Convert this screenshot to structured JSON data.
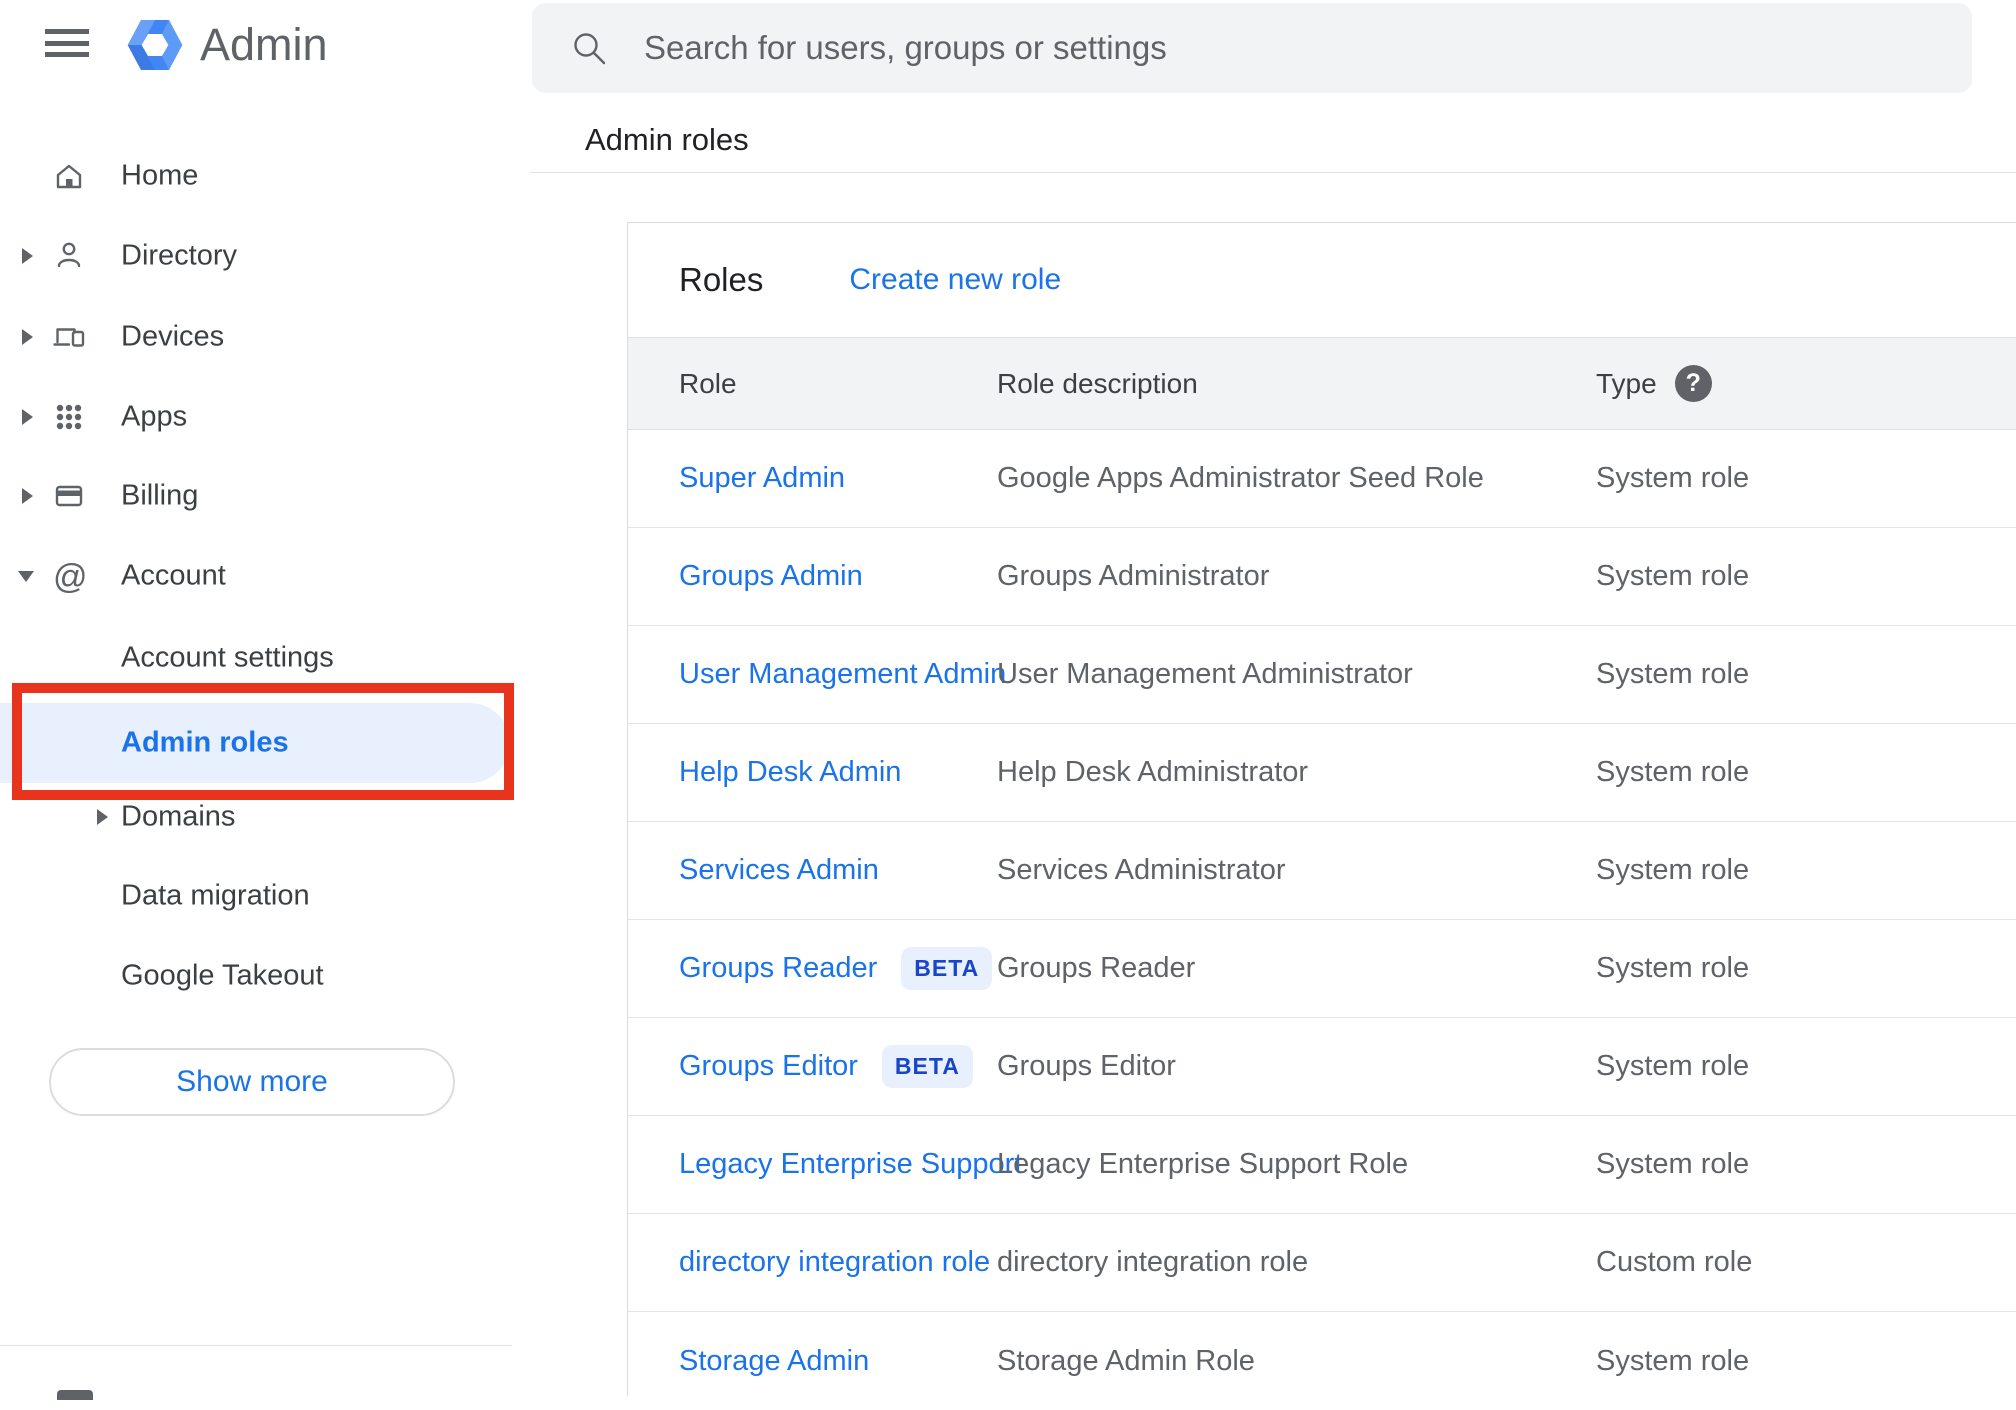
{
  "app": {
    "name": "Admin"
  },
  "search": {
    "placeholder": "Search for users, groups or settings"
  },
  "page": {
    "title": "Admin roles"
  },
  "sidebar": {
    "items": [
      {
        "label": "Home"
      },
      {
        "label": "Directory"
      },
      {
        "label": "Devices"
      },
      {
        "label": "Apps"
      },
      {
        "label": "Billing"
      },
      {
        "label": "Account"
      }
    ],
    "account_children": [
      {
        "label": "Account settings"
      },
      {
        "label": "Admin roles",
        "active": true
      },
      {
        "label": "Domains"
      },
      {
        "label": "Data migration"
      },
      {
        "label": "Google Takeout"
      }
    ],
    "show_more_label": "Show more"
  },
  "card": {
    "title": "Roles",
    "create_link": "Create new role",
    "columns": {
      "role": "Role",
      "description": "Role description",
      "type": "Type"
    },
    "help_icon": "?",
    "rows": [
      {
        "role": "Super Admin",
        "description": "Google Apps Administrator Seed Role",
        "type": "System role"
      },
      {
        "role": "Groups Admin",
        "description": "Groups Administrator",
        "type": "System role"
      },
      {
        "role": "User Management Admin",
        "description": "User Management Administrator",
        "type": "System role"
      },
      {
        "role": "Help Desk Admin",
        "description": "Help Desk Administrator",
        "type": "System role"
      },
      {
        "role": "Services Admin",
        "description": "Services Administrator",
        "type": "System role"
      },
      {
        "role": "Groups Reader",
        "badge": "BETA",
        "description": "Groups Reader",
        "type": "System role"
      },
      {
        "role": "Groups Editor",
        "badge": "BETA",
        "description": "Groups Editor",
        "type": "System role"
      },
      {
        "role": "Legacy Enterprise Support",
        "description": "Legacy Enterprise Support Role",
        "type": "System role"
      },
      {
        "role": "directory integration role",
        "description": "directory integration role",
        "type": "Custom role"
      },
      {
        "role": "Storage Admin",
        "description": "Storage Admin Role",
        "type": "System role"
      }
    ]
  },
  "colors": {
    "accent_blue": "#1a73e8",
    "annotation_red": "#e8341c",
    "highlight_bg": "#e8f0fe",
    "beta_text": "#1946c8",
    "beta_bg": "#e8f0fe",
    "header_band_bg": "#f1f3f4",
    "logo_blue": "#4285f4"
  }
}
